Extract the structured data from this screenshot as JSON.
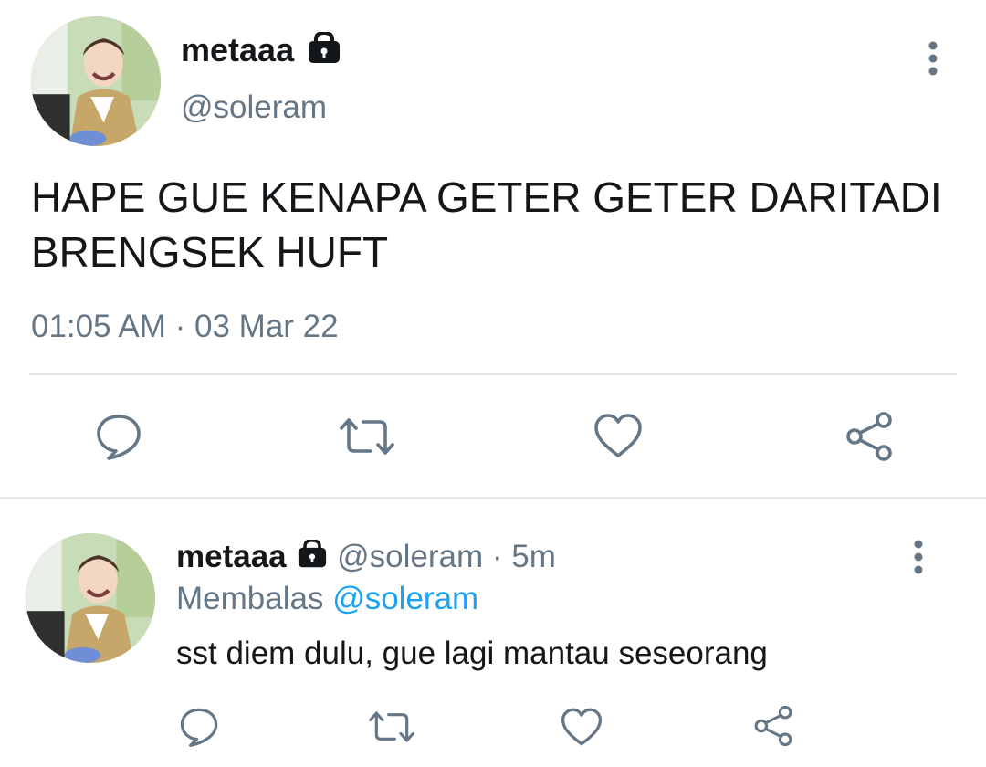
{
  "main_tweet": {
    "display_name": "metaaa",
    "handle": "@soleram",
    "text_line1": "HAPE GUE KENAPA GETER GETER DARITADI",
    "text_line2": "BRENGSEK HUFT",
    "time": "01:05 AM",
    "separator": "·",
    "date": "03 Mar 22"
  },
  "reply_tweet": {
    "display_name": "metaaa",
    "handle": "@soleram",
    "separator": "·",
    "age": "5m",
    "replying_prefix": "Membalas",
    "replying_to": "@soleram",
    "text": "sst diem dulu, gue lagi mantau seseorang"
  },
  "icons": {
    "lock": "lock-icon",
    "more": "more-vertical-icon",
    "reply": "reply-icon",
    "retweet": "retweet-icon",
    "like": "heart-icon",
    "share": "share-icon"
  },
  "colors": {
    "text": "#14171a",
    "muted": "#657786",
    "link": "#1da1f2",
    "divider": "#e1e8ed"
  }
}
